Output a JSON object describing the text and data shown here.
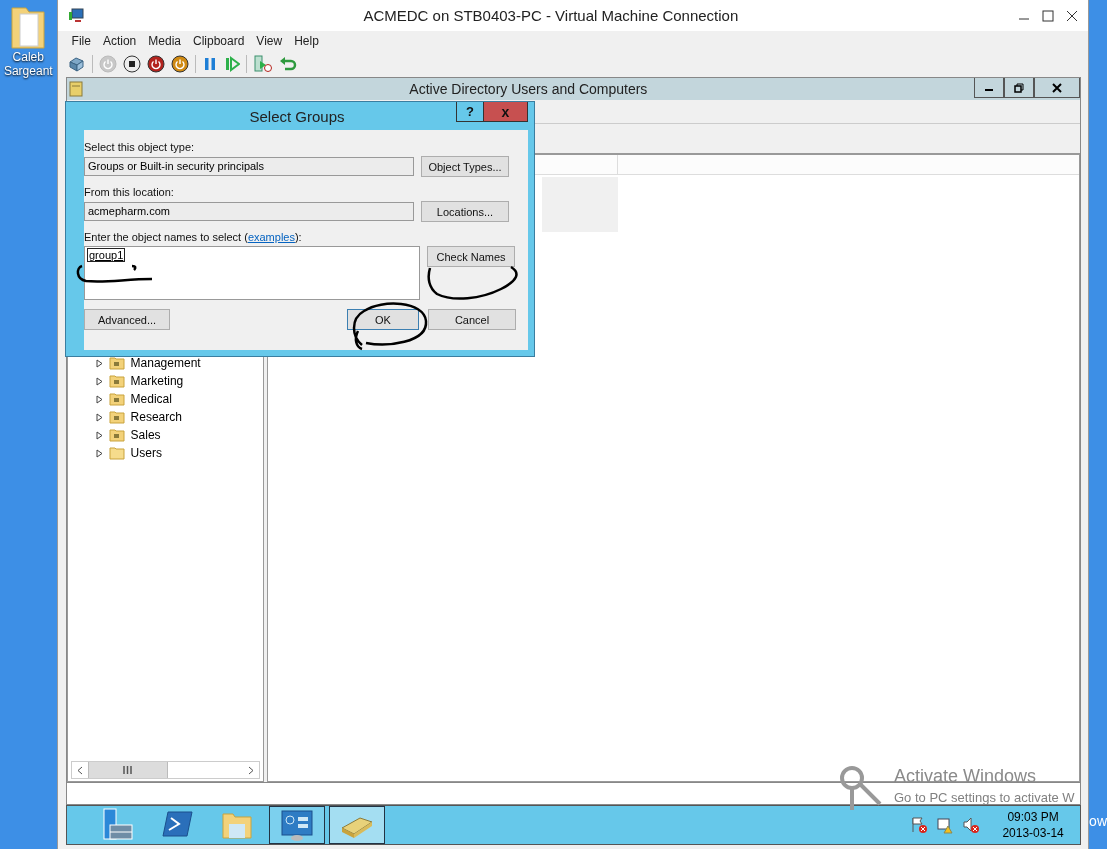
{
  "desktop": {
    "icons": [
      {
        "label": "Caleb Sargeant"
      }
    ],
    "edge_text": "ow"
  },
  "vm_window": {
    "title": "ACMEDC on STB0403-PC - Virtual Machine Connection",
    "menu": [
      "File",
      "Action",
      "Media",
      "Clipboard",
      "View",
      "Help"
    ],
    "toolbar": [
      {
        "kind": "ctrl-alt-del",
        "disabled": false
      },
      {
        "kind": "separator"
      },
      {
        "kind": "start",
        "disabled": true
      },
      {
        "kind": "turn-off",
        "disabled": false
      },
      {
        "kind": "shut-down",
        "disabled": false
      },
      {
        "kind": "save",
        "disabled": false
      },
      {
        "kind": "separator"
      },
      {
        "kind": "pause",
        "disabled": false
      },
      {
        "kind": "reset",
        "disabled": false
      },
      {
        "kind": "separator"
      },
      {
        "kind": "checkpoint",
        "disabled": false
      },
      {
        "kind": "revert",
        "disabled": false
      }
    ]
  },
  "aduc": {
    "title": "Active Directory Users and Computers",
    "tree": [
      {
        "label": "Management",
        "kind": "ou",
        "expanded": false
      },
      {
        "label": "Marketing",
        "kind": "ou",
        "expanded": false
      },
      {
        "label": "Medical",
        "kind": "ou",
        "expanded": false
      },
      {
        "label": "Research",
        "kind": "ou",
        "expanded": false
      },
      {
        "label": "Sales",
        "kind": "ou",
        "expanded": false
      },
      {
        "label": "Users",
        "kind": "container",
        "expanded": false
      }
    ]
  },
  "dialog": {
    "title": "Select Groups",
    "help": "?",
    "close": "x",
    "object_type_label": "Select this object type:",
    "object_type": "Groups or Built-in security principals",
    "object_types_button": "Object Types...",
    "location_label": "From this location:",
    "location": "acmepharm.com",
    "locations_button": "Locations...",
    "names_label_before": "Enter the object names to select (",
    "names_label_link": "examples",
    "names_label_after": "):",
    "names": "group1",
    "check_names_button": "Check Names",
    "advanced_button": "Advanced...",
    "ok_button": "OK",
    "cancel_button": "Cancel"
  },
  "taskbar": {
    "apps": [
      {
        "kind": "server-manager",
        "open": false,
        "selected": false
      },
      {
        "kind": "powershell",
        "open": false,
        "selected": false
      },
      {
        "kind": "explorer",
        "open": false,
        "selected": false
      },
      {
        "kind": "control-panel",
        "open": true,
        "selected": false
      },
      {
        "kind": "directory",
        "open": true,
        "selected": true
      }
    ],
    "tray": [
      {
        "kind": "flag-error"
      },
      {
        "kind": "network-warning"
      },
      {
        "kind": "sound-muted"
      }
    ],
    "time": "09:03 PM",
    "date": "2013-03-14"
  },
  "watermark": {
    "title": "Activate Windows",
    "subtitle": "Go to PC settings to activate W"
  }
}
